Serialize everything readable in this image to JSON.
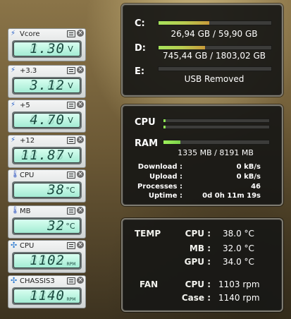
{
  "gadgets": [
    {
      "label": "Vcore",
      "icon": "lightning-icon",
      "value": "1.30",
      "unit": "V"
    },
    {
      "label": "+3.3",
      "icon": "lightning-icon",
      "value": "3.12",
      "unit": "V"
    },
    {
      "label": "+5",
      "icon": "lightning-icon",
      "value": "4.70",
      "unit": "V"
    },
    {
      "label": "+12",
      "icon": "lightning-icon",
      "value": "11.87",
      "unit": "V"
    },
    {
      "label": "CPU",
      "icon": "thermometer-icon",
      "value": "38",
      "unit": "°C"
    },
    {
      "label": "MB",
      "icon": "thermometer-icon",
      "value": "32",
      "unit": "°C"
    },
    {
      "label": "CPU",
      "icon": "fan-icon",
      "value": "1102",
      "unit": "RPM"
    },
    {
      "label": "CHASSIS3",
      "icon": "fan-icon",
      "value": "1140",
      "unit": "RPM"
    }
  ],
  "drives": [
    {
      "letter": "C:",
      "info": "26,94 GB / 59,90 GB",
      "fill": 0.45
    },
    {
      "letter": "D:",
      "info": "745,44 GB / 1803,02 GB",
      "fill": 0.41
    },
    {
      "letter": "E:",
      "info": "USB Removed",
      "fill": 0
    }
  ],
  "system": {
    "cpu_label": "CPU",
    "cpu_core_fill": [
      0.02,
      0.02
    ],
    "ram_label": "RAM",
    "ram_fill": 0.16,
    "ram_info": "1335 MB / 8191 MB",
    "stats": [
      {
        "label": "Download :",
        "value": "0 kB/s"
      },
      {
        "label": "Upload :",
        "value": "0 kB/s"
      },
      {
        "label": "Processes :",
        "value": "46"
      },
      {
        "label": "Uptime :",
        "value": "0d 0h 11m 19s"
      }
    ]
  },
  "sensors": {
    "temp_title": "TEMP",
    "fan_title": "FAN",
    "temps": [
      {
        "label": "CPU :",
        "value": "38.0 °C"
      },
      {
        "label": "MB :",
        "value": "32.0 °C"
      },
      {
        "label": "GPU :",
        "value": "34.0 °C"
      }
    ],
    "fans": [
      {
        "label": "CPU :",
        "value": "1103 rpm"
      },
      {
        "label": "Case :",
        "value": "1140 rpm"
      }
    ]
  },
  "colors": {
    "lcd_background": "#b8f5e0",
    "lcd_text": "#1b4a40",
    "panel_background": "#181816",
    "bar_fill": "#a6e25b"
  }
}
